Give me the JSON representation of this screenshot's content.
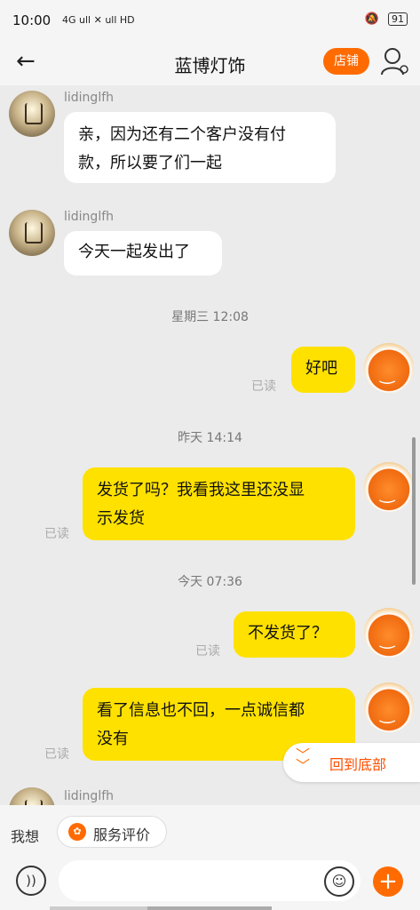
{
  "status_bar": {
    "time": "10:00",
    "network": "4G ull ✕ ull HD",
    "battery": "91"
  },
  "header": {
    "title": "蓝博灯饰",
    "shop_button": "店铺"
  },
  "messages": [
    {
      "side": "left",
      "nickname": "lidinglfh",
      "text_lines": [
        "亲，因为还有二个客户没有付",
        "款，所以要了们一起"
      ]
    },
    {
      "side": "left",
      "nickname": "lidinglfh",
      "text_lines": [
        "今天一起发出了"
      ]
    },
    {
      "type": "timestamp",
      "text": "星期三 12:08"
    },
    {
      "side": "right",
      "text_lines": [
        "好吧"
      ],
      "status": "已读"
    },
    {
      "type": "timestamp",
      "text": "昨天  14:14"
    },
    {
      "side": "right",
      "text_lines": [
        "发货了吗？我看我这里还没显",
        "示发货"
      ],
      "status": "已读"
    },
    {
      "type": "timestamp",
      "text": "今天  07:36"
    },
    {
      "side": "right",
      "text_lines": [
        "不发货了？"
      ],
      "status": "已读"
    },
    {
      "side": "right",
      "text_lines": [
        "看了信息也不回，一点诚信都",
        "没有"
      ],
      "status": "已读"
    },
    {
      "side": "left",
      "nickname": "lidinglfh"
    }
  ],
  "jump_to_bottom": "回到底部",
  "quick_bar": {
    "label": "我想",
    "service_button": "服务评价"
  },
  "colors": {
    "accent": "#ff6b00",
    "sent_bubble": "#ffe100",
    "received_bubble": "#ffffff"
  }
}
